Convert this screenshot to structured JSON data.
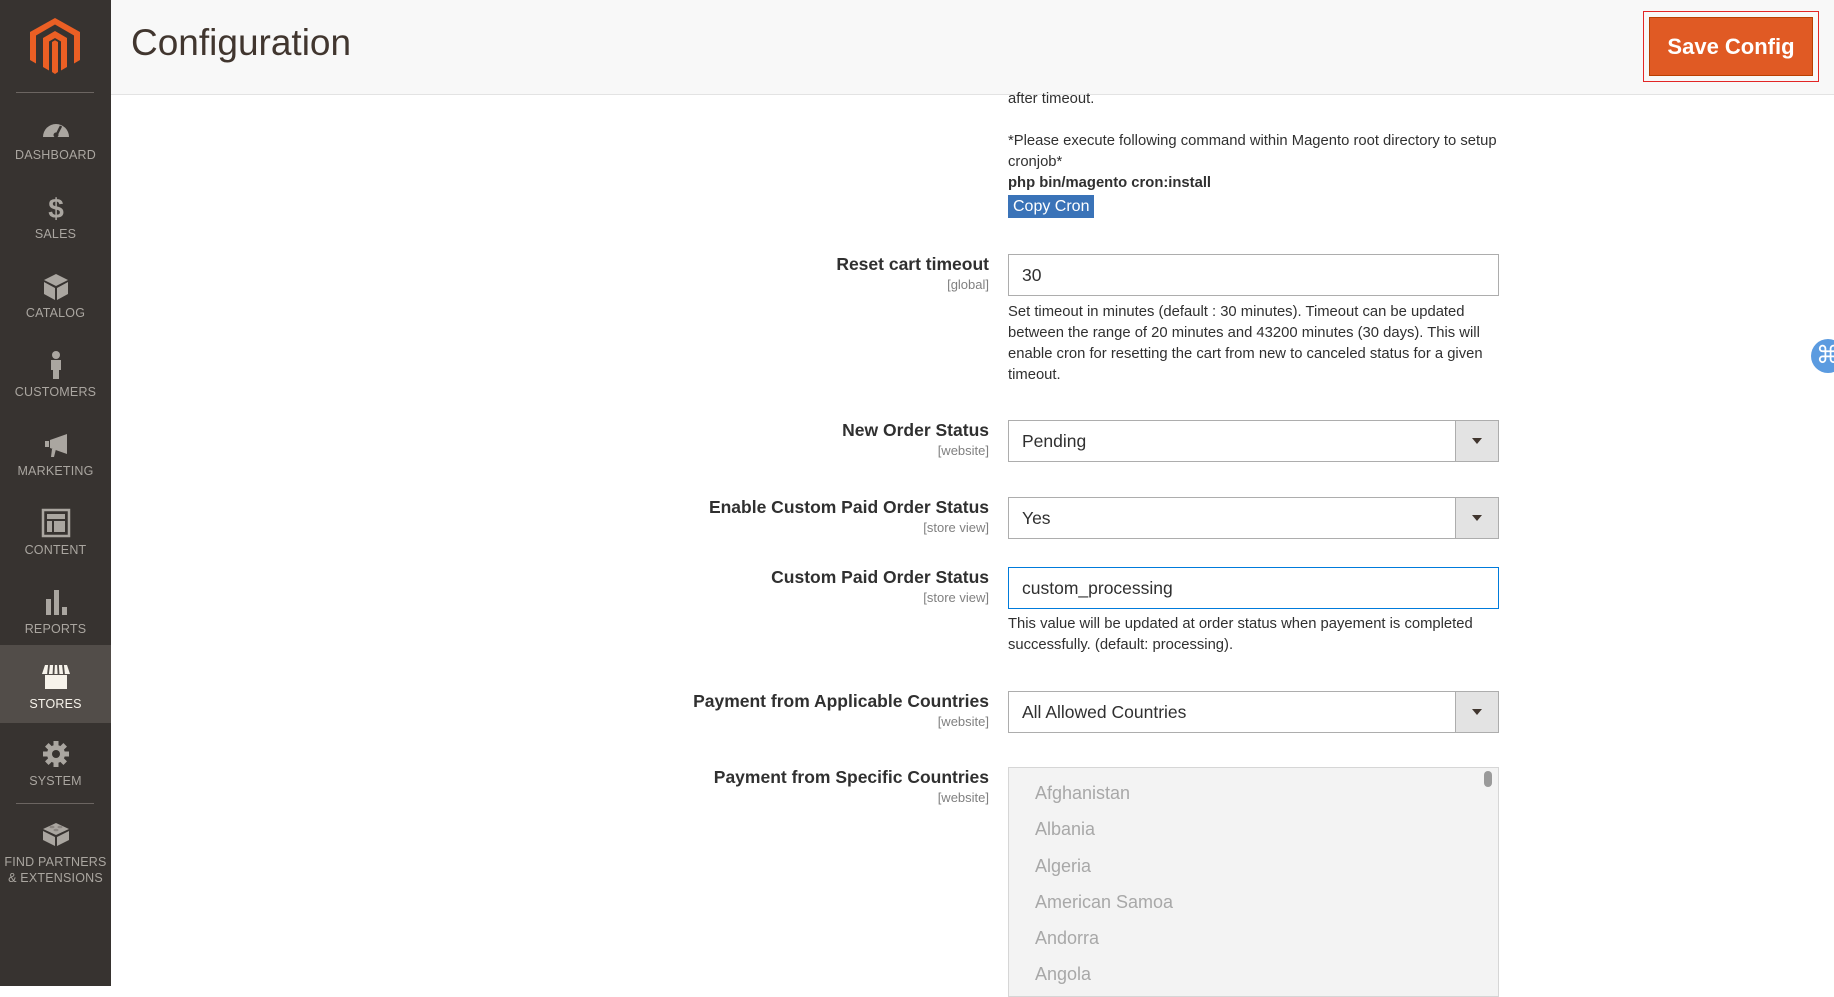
{
  "sidebar": {
    "items": [
      {
        "label": "DASHBOARD",
        "icon": "dashboard-icon"
      },
      {
        "label": "SALES",
        "icon": "dollar-icon"
      },
      {
        "label": "CATALOG",
        "icon": "box-icon"
      },
      {
        "label": "CUSTOMERS",
        "icon": "person-icon"
      },
      {
        "label": "MARKETING",
        "icon": "megaphone-icon"
      },
      {
        "label": "CONTENT",
        "icon": "layout-icon"
      },
      {
        "label": "REPORTS",
        "icon": "bar-chart-icon"
      },
      {
        "label": "STORES",
        "icon": "storefront-icon",
        "active": true
      },
      {
        "label": "SYSTEM",
        "icon": "gear-icon"
      },
      {
        "label": "FIND PARTNERS",
        "label2": "& EXTENSIONS",
        "icon": "lego-brick-icon"
      }
    ]
  },
  "header": {
    "title": "Configuration",
    "save_label": "Save Config"
  },
  "colors": {
    "accent": "#eb5202",
    "sidebar_bg": "#373330",
    "copy_button": "#3a73b8",
    "focus_border": "#007bdb"
  },
  "top_note": {
    "line_prev": "after timeout.",
    "instruction": "*Please execute following command within Magento root directory to setup cronjob*",
    "command": "php bin/magento cron:install",
    "copy_label": "Copy Cron"
  },
  "fields": {
    "reset_cart": {
      "label": "Reset cart timeout",
      "scope": "[global]",
      "value": "30",
      "note": "Set timeout in minutes (default : 30 minutes). Timeout can be updated between the range of 20 minutes and 43200 minutes (30 days). This will enable cron for resetting the cart from new to canceled status for a given timeout."
    },
    "new_order_status": {
      "label": "New Order Status",
      "scope": "[website]",
      "value": "Pending"
    },
    "enable_custom_paid": {
      "label": "Enable Custom Paid Order Status",
      "scope": "[store view]",
      "value": "Yes"
    },
    "custom_paid": {
      "label": "Custom Paid Order Status",
      "scope": "[store view]",
      "value": "custom_processing",
      "note": "This value will be updated at order status when payement is completed successfully. (default: processing)."
    },
    "applicable_countries": {
      "label": "Payment from Applicable Countries",
      "scope": "[website]",
      "value": "All Allowed Countries"
    },
    "specific_countries": {
      "label": "Payment from Specific Countries",
      "scope": "[website]",
      "options": [
        "Afghanistan",
        "Albania",
        "Algeria",
        "American Samoa",
        "Andorra",
        "Angola"
      ]
    }
  },
  "floating_icon": "command-key-icon"
}
